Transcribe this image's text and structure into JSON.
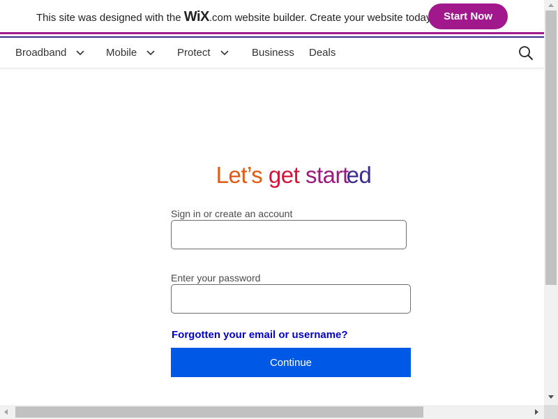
{
  "wix_banner": {
    "text_before": "This site was designed with the ",
    "logo": "WiX",
    "logo_suffix": ".com",
    "text_after": " website builder. Create your website today.",
    "button_label": "Start Now",
    "accent_color": "#a0188c"
  },
  "nav": {
    "items": [
      {
        "label": "Broadband",
        "has_dropdown": true
      },
      {
        "label": "Mobile",
        "has_dropdown": true
      },
      {
        "label": "Protect",
        "has_dropdown": true
      },
      {
        "label": "Business",
        "has_dropdown": false
      },
      {
        "label": "Deals",
        "has_dropdown": false
      }
    ],
    "search_icon": "search-icon",
    "dropdown_icon": "chevron-down-icon"
  },
  "main": {
    "title_words": [
      "Let’s",
      "get",
      "start",
      "ed"
    ],
    "title_colors": [
      "#e05a12",
      "#d3153a",
      "#9a1a7e",
      "#3a2b8c"
    ],
    "account_label": "Sign in or create an account",
    "account_value": "",
    "password_label": "Enter your password",
    "password_value": "",
    "forgot_link": "Forgotten your email or username?",
    "continue_label": "Continue",
    "continue_color": "#0058e6"
  }
}
